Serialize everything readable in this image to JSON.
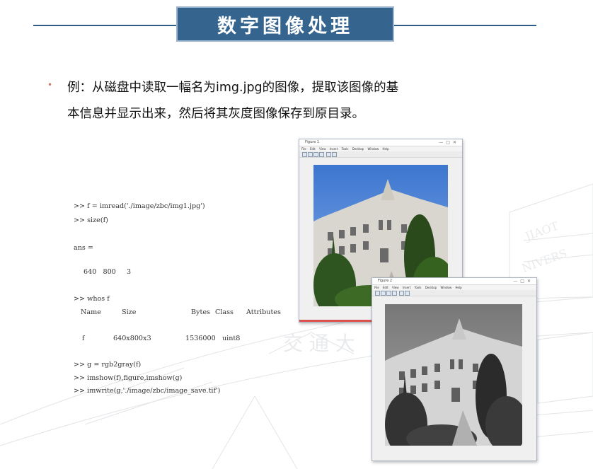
{
  "header": {
    "title": "数字图像处理"
  },
  "body": {
    "bullet": "•",
    "line1": "例：从磁盘中读取一幅名为img.jpg的图像，提取该图像的基",
    "line2": "本信息并显示出来，然后将其灰度图像保存到原目录。"
  },
  "console": {
    "cmd1": ">> f = imread('./image/zbc/img1.jpg')",
    "cmd2": ">> size(f)",
    "ans_label": "ans =",
    "ans_values": "640   800     3",
    "cmd3": ">> whos f",
    "whos_headers": [
      "Name",
      "Size",
      "Bytes",
      "Class",
      "Attributes"
    ],
    "whos_row": [
      "f",
      "640x800x3",
      "1536000",
      "uint8",
      ""
    ],
    "cmd4": ">> g = rgb2gray(f)",
    "cmd5": ">> imshow(f),figure,imshow(g)",
    "cmd6": ">> imwrite(g,'./image/zbc/image_save.tif')"
  },
  "figure1": {
    "title": "Figure 1",
    "menu": [
      "File",
      "Edit",
      "View",
      "Insert",
      "Tools",
      "Desktop",
      "Window",
      "Help"
    ],
    "image": "color-building-photo"
  },
  "figure2": {
    "title": "Figure 2",
    "menu": [
      "File",
      "Edit",
      "View",
      "Insert",
      "Tools",
      "Desktop",
      "Window",
      "Help"
    ],
    "image": "grayscale-building-photo"
  },
  "colors": {
    "title_bg": "#35648f",
    "title_line": "#2f5d88",
    "bullet": "#d07a6a",
    "sky": "#5a8fd8"
  }
}
